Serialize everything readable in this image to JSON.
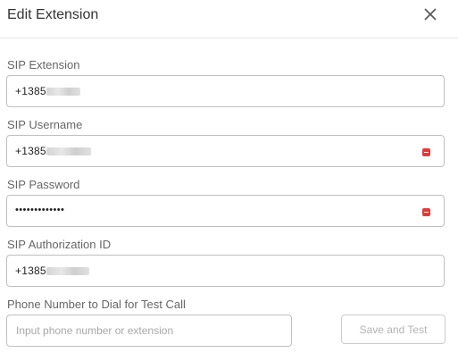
{
  "dialog": {
    "title": "Edit Extension",
    "close_icon": "close-icon"
  },
  "fields": {
    "sip_extension": {
      "label": "SIP Extension",
      "value_prefix": "+1385"
    },
    "sip_username": {
      "label": "SIP Username",
      "value_prefix": "+1385"
    },
    "sip_password": {
      "label": "SIP Password",
      "masked_value": "•••••••••••••"
    },
    "sip_authorization_id": {
      "label": "SIP Authorization ID",
      "value_prefix": "+1385"
    }
  },
  "test_call": {
    "label": "Phone Number to Dial for Test Call",
    "placeholder": "Input phone number or extension",
    "button_label": "Save and Test"
  },
  "colors": {
    "key_badge": "#e23a3a",
    "border": "#bfbfbf"
  }
}
